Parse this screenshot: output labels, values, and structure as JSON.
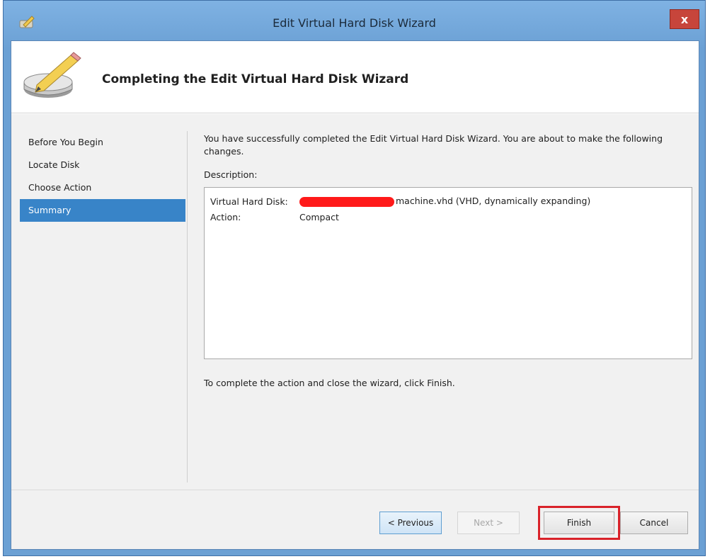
{
  "window": {
    "title": "Edit Virtual Hard Disk Wizard",
    "close_label": "x"
  },
  "header": {
    "title": "Completing the Edit Virtual Hard Disk Wizard"
  },
  "nav": {
    "items": [
      {
        "label": "Before You Begin"
      },
      {
        "label": "Locate Disk"
      },
      {
        "label": "Choose Action"
      },
      {
        "label": "Summary"
      }
    ],
    "selected": "Summary"
  },
  "content": {
    "intro": "You have successfully completed the Edit Virtual Hard Disk Wizard. You are about to make the following changes.",
    "description_label": "Description:",
    "rows": [
      {
        "key": "Virtual Hard Disk:",
        "value": "machine.vhd (VHD, dynamically expanding)"
      },
      {
        "key": "Action:",
        "value": "Compact"
      }
    ],
    "finish_hint": "To complete the action and close the wizard, click Finish."
  },
  "footer": {
    "previous_label": "< Previous",
    "next_label": "Next >",
    "finish_label": "Finish",
    "cancel_label": "Cancel"
  },
  "colors": {
    "selection": "#3884c8",
    "frame": "#6ba0d4",
    "highlight": "#d9222a",
    "redaction": "#ff1a1a"
  }
}
